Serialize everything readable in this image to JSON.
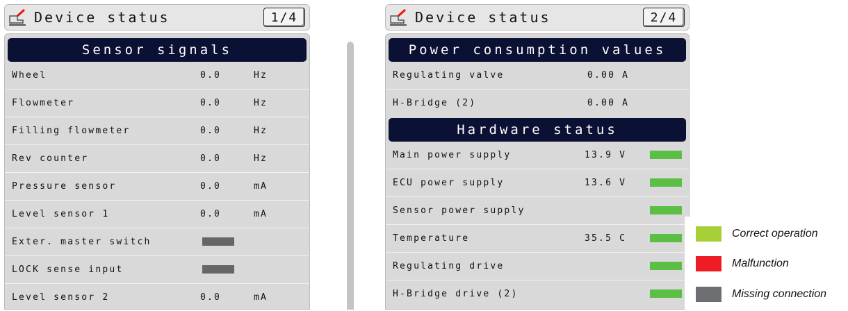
{
  "panel1": {
    "title": "Device status",
    "page": "1/4",
    "section": "Sensor signals",
    "rows": [
      {
        "label": "Wheel",
        "value": "0.0",
        "unit": "Hz"
      },
      {
        "label": "Flowmeter",
        "value": "0.0",
        "unit": "Hz"
      },
      {
        "label": "Filling flowmeter",
        "value": "0.0",
        "unit": "Hz"
      },
      {
        "label": "Rev counter",
        "value": "0.0",
        "unit": "Hz"
      },
      {
        "label": "Pressure sensor",
        "value": "0.0",
        "unit": "mA"
      },
      {
        "label": "Level sensor 1",
        "value": "0.0",
        "unit": "mA"
      },
      {
        "label": "Exter. master switch",
        "indicator": "missing"
      },
      {
        "label": "LOCK sense input",
        "indicator": "missing"
      },
      {
        "label": "Level sensor 2",
        "value": "0.0",
        "unit": "mA"
      }
    ]
  },
  "panel2": {
    "title": "Device status",
    "page": "2/4",
    "section1": "Power consumption values",
    "rows1": [
      {
        "label": "Regulating valve",
        "value": "0.00 A"
      },
      {
        "label": "H-Bridge (2)",
        "value": "0.00 A"
      }
    ],
    "section2": "Hardware status",
    "rows2": [
      {
        "label": "Main power supply",
        "value": "13.9 V",
        "indicator": "correct"
      },
      {
        "label": "ECU power supply",
        "value": "13.6 V",
        "indicator": "correct"
      },
      {
        "label": "Sensor power supply",
        "value": "",
        "indicator": "correct"
      },
      {
        "label": "Temperature",
        "value": "35.5 C",
        "indicator": "correct"
      },
      {
        "label": "Regulating drive",
        "value": "",
        "indicator": "correct"
      },
      {
        "label": "H-Bridge drive (2)",
        "value": "",
        "indicator": "correct"
      }
    ]
  },
  "legend": [
    {
      "label": "Correct operation",
      "color": "#a6cf38"
    },
    {
      "label": "Malfunction",
      "color": "#ee1c25"
    },
    {
      "label": "Missing connection",
      "color": "#6d6e71"
    }
  ],
  "colors": {
    "section_bg": "#0b1035",
    "indicator_ok": "#5cbf45",
    "indicator_missing": "#666666"
  }
}
